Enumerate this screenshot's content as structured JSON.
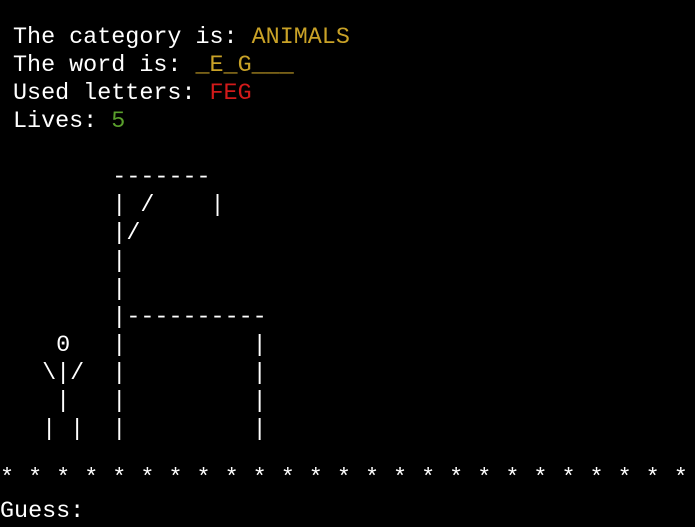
{
  "category": {
    "label": "The category is: ",
    "value": "ANIMALS"
  },
  "word": {
    "label": "The word is: ",
    "value": "_E_G___"
  },
  "used_letters": {
    "label": "Used letters: ",
    "value": "FEG"
  },
  "lives": {
    "label": "Lives: ",
    "value": "5"
  },
  "gallows_art": "        -------\n        | /    |\n        |/\n        |\n        |\n        |----------\n    0   |         |\n   \\|/  |         |\n    |   |         |\n   | |  |         |",
  "separator": "* * * * * * * * * * * * * * * * * * * * * * * * *",
  "input": {
    "label": "Guess: ",
    "value": ""
  },
  "colors": {
    "background": "#000000",
    "text": "#ffffff",
    "category_value": "#c9a227",
    "word_value": "#c9a227",
    "used_letters_value": "#d21a1a",
    "lives_value": "#5aa02c"
  }
}
